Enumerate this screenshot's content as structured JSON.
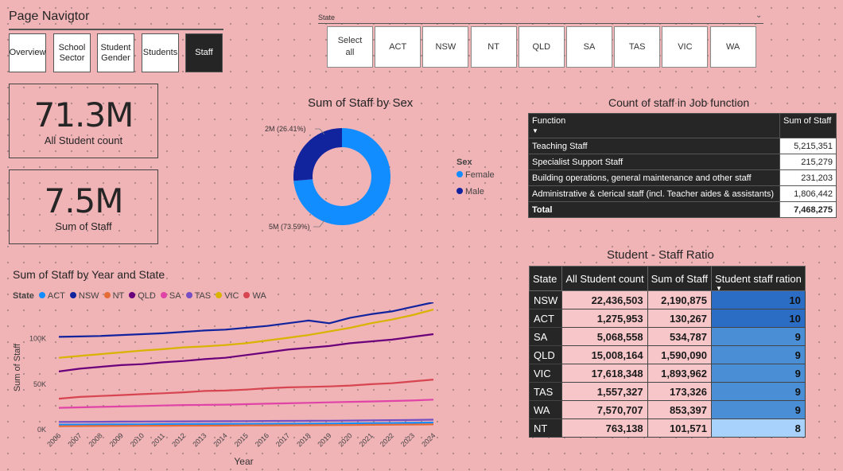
{
  "nav": {
    "title": "Page Navigtor",
    "buttons": [
      {
        "label": "Overview",
        "active": false
      },
      {
        "label": "School Sector",
        "active": false
      },
      {
        "label": "Student Gender",
        "active": false
      },
      {
        "label": "Students",
        "active": false
      },
      {
        "label": "Staff",
        "active": true
      }
    ]
  },
  "slicer": {
    "title": "State",
    "options": [
      "Select all",
      "ACT",
      "NSW",
      "NT",
      "QLD",
      "SA",
      "TAS",
      "VIC",
      "WA"
    ]
  },
  "kpis": [
    {
      "value": "71.3M",
      "label": "All Student count"
    },
    {
      "value": "7.5M",
      "label": "Sum of Staff"
    }
  ],
  "donut": {
    "title": "Sum of Staff by Sex",
    "legend_title": "Sex",
    "slices": [
      {
        "label": "Female",
        "value": 73.59,
        "display": "5M (73.59%)",
        "color": "#118dff"
      },
      {
        "label": "Male",
        "value": 26.41,
        "display": "2M (26.41%)",
        "color": "#12239e"
      }
    ]
  },
  "job_table": {
    "title": "Count of staff in Job function",
    "headers": [
      "Function",
      "Sum of Staff"
    ],
    "rows": [
      [
        "Teaching Staff",
        "5,215,351"
      ],
      [
        "Specialist Support Staff",
        "215,279"
      ],
      [
        "Building operations, general maintenance and other staff",
        "231,203"
      ],
      [
        "Administrative & clerical staff (incl. Teacher aides & assistants)",
        "1,806,442"
      ]
    ],
    "total": [
      "Total",
      "7,468,275"
    ]
  },
  "ratio_table": {
    "title": "Student - Staff Ratio",
    "headers": [
      "State",
      "All Student count",
      "Sum of Staff",
      "Student staff ration"
    ],
    "rows": [
      {
        "state": "NSW",
        "students": "22,436,503",
        "staff": "2,190,875",
        "ratio": 10
      },
      {
        "state": "ACT",
        "students": "1,275,953",
        "staff": "130,267",
        "ratio": 10
      },
      {
        "state": "SA",
        "students": "5,068,558",
        "staff": "534,787",
        "ratio": 9
      },
      {
        "state": "QLD",
        "students": "15,008,164",
        "staff": "1,590,090",
        "ratio": 9
      },
      {
        "state": "VIC",
        "students": "17,618,348",
        "staff": "1,893,962",
        "ratio": 9
      },
      {
        "state": "TAS",
        "students": "1,557,327",
        "staff": "173,326",
        "ratio": 9
      },
      {
        "state": "WA",
        "students": "7,570,707",
        "staff": "853,397",
        "ratio": 9
      },
      {
        "state": "NT",
        "students": "763,138",
        "staff": "101,571",
        "ratio": 8
      }
    ],
    "ratio_colors": {
      "10": "#2b6cc4",
      "9": "#4a8fd6",
      "8": "#a8d2fb"
    }
  },
  "chart_data": {
    "type": "line",
    "title": "Sum of Staff by Year and State",
    "xlabel": "Year",
    "ylabel": "Sum of Staff",
    "legend_title": "State",
    "yticks": [
      "0K",
      "50K",
      "100K"
    ],
    "ylim": [
      0,
      140000
    ],
    "x": [
      "2006",
      "2007",
      "2008",
      "2009",
      "2010",
      "2011",
      "2012",
      "2013",
      "2014",
      "2015",
      "2016",
      "2017",
      "2018",
      "2019",
      "2020",
      "2021",
      "2022",
      "2023",
      "2024"
    ],
    "series": [
      {
        "name": "ACT",
        "color": "#118dff",
        "values": [
          5500,
          5600,
          5700,
          5800,
          5900,
          6000,
          6100,
          6150,
          6200,
          6300,
          6400,
          6500,
          6600,
          6700,
          6900,
          7100,
          7300,
          7500,
          7800
        ]
      },
      {
        "name": "NSW",
        "color": "#12239e",
        "values": [
          102000,
          102500,
          103000,
          104000,
          105000,
          106000,
          107500,
          109000,
          110000,
          112000,
          114000,
          117000,
          120000,
          117000,
          123000,
          127000,
          130000,
          135000,
          140000
        ]
      },
      {
        "name": "NT",
        "color": "#e66c37",
        "values": [
          3800,
          3900,
          4000,
          4100,
          4200,
          4300,
          4400,
          4400,
          4500,
          4600,
          4700,
          4800,
          4900,
          5000,
          5100,
          5300,
          5400,
          5600,
          5800
        ]
      },
      {
        "name": "QLD",
        "color": "#6b007b",
        "values": [
          64000,
          67000,
          69000,
          71000,
          72000,
          74000,
          75500,
          77500,
          79000,
          82000,
          85000,
          88000,
          90000,
          92000,
          95000,
          97000,
          99000,
          102000,
          105000
        ]
      },
      {
        "name": "SA",
        "color": "#e044a7",
        "values": [
          24000,
          24500,
          25000,
          25500,
          26000,
          26500,
          27000,
          27200,
          27500,
          28000,
          28500,
          29000,
          29500,
          30000,
          30500,
          31000,
          31500,
          32000,
          33000
        ]
      },
      {
        "name": "TAS",
        "color": "#744ec2",
        "values": [
          8500,
          8600,
          8700,
          8800,
          8900,
          9000,
          9100,
          9200,
          9300,
          9400,
          9500,
          9600,
          9700,
          9800,
          10000,
          10200,
          10400,
          10600,
          10900
        ]
      },
      {
        "name": "VIC",
        "color": "#d9b300",
        "values": [
          79000,
          81000,
          83000,
          85000,
          87000,
          88500,
          90500,
          91500,
          93000,
          95000,
          98000,
          101000,
          104000,
          108000,
          112000,
          117000,
          121000,
          126000,
          132000
        ]
      },
      {
        "name": "WA",
        "color": "#d64550",
        "values": [
          34000,
          36000,
          37000,
          38000,
          39000,
          40000,
          41000,
          42500,
          43000,
          44000,
          45500,
          46500,
          47000,
          47500,
          48500,
          50000,
          51000,
          53000,
          55000
        ]
      }
    ]
  }
}
